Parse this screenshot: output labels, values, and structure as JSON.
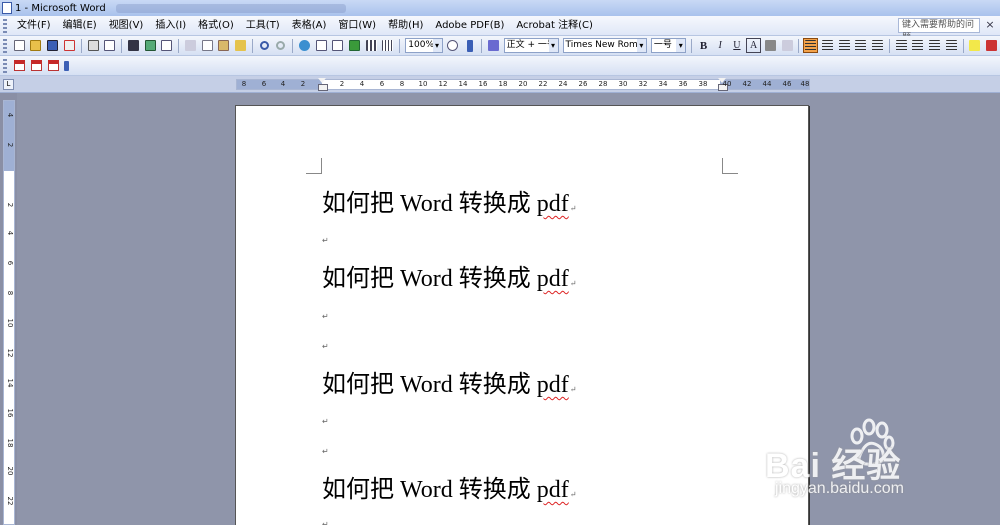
{
  "window": {
    "title": "1 - Microsoft Word"
  },
  "menu": {
    "items": [
      "文件(F)",
      "编辑(E)",
      "视图(V)",
      "插入(I)",
      "格式(O)",
      "工具(T)",
      "表格(A)",
      "窗口(W)",
      "帮助(H)",
      "Adobe PDF(B)",
      "Acrobat 注释(C)"
    ],
    "help_placeholder": "键入需要帮助的问题",
    "close_glyph": "×"
  },
  "toolbar": {
    "zoom": "100%",
    "style": "正文 + 一号",
    "font": "Times New Roman",
    "size": "一号",
    "bold_label": "B",
    "italic_label": "I",
    "underline_label": "U",
    "char_border_label": "A"
  },
  "ruler": {
    "corner_label": "L",
    "h_numbers": [
      "8",
      "6",
      "4",
      "2",
      "2",
      "4",
      "6",
      "8",
      "10",
      "12",
      "14",
      "16",
      "18",
      "20",
      "22",
      "24",
      "26",
      "28",
      "30",
      "32",
      "34",
      "36",
      "38",
      "40",
      "42",
      "44",
      "46",
      "48"
    ],
    "v_numbers": [
      "4",
      "2",
      "2",
      "4",
      "6",
      "8",
      "10",
      "12",
      "14",
      "16",
      "18",
      "20",
      "22"
    ]
  },
  "document": {
    "text_main": "如何把 Word 转换成 ",
    "text_pdf": "pdf",
    "para_mark": "↵"
  },
  "watermark": {
    "brand": "Bai 经验",
    "url": "jingyan.baidu.com"
  },
  "colors": {
    "titlebar": "#b9cdf1",
    "toolbar": "#dfe7f7",
    "workspace": "#8f95aa",
    "spell_underline": "#d22222"
  }
}
